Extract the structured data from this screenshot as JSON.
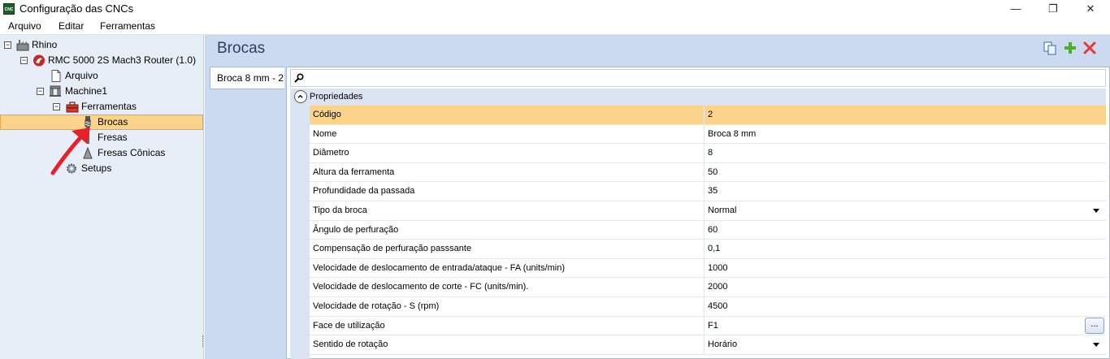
{
  "window": {
    "icon_text": "CNC",
    "title": "Configuração das CNCs",
    "minimize": "—",
    "maximize": "❐",
    "close": "✕"
  },
  "menu": [
    "Arquivo",
    "Editar",
    "Ferramentas"
  ],
  "tree": {
    "root": "Rhino",
    "machine_config": "RMC 5000 2S Mach3 Router (1.0)",
    "arquivo": "Arquivo",
    "machine": "Machine1",
    "ferramentas": "Ferramentas",
    "brocas": "Brocas",
    "fresas": "Fresas",
    "fresas_conicas": "Fresas Cônicas",
    "setups": "Setups",
    "collapse_glyph": "−"
  },
  "panel": {
    "title": "Brocas",
    "tab_label": "Broca 8 mm - 2",
    "category": "Propriedades",
    "ellipsis": "..."
  },
  "properties": [
    {
      "name": "Código",
      "value": "2"
    },
    {
      "name": "Nome",
      "value": "Broca 8 mm"
    },
    {
      "name": "Diâmetro",
      "value": "8"
    },
    {
      "name": "Altura da ferramenta",
      "value": "50"
    },
    {
      "name": "Profundidade da passada",
      "value": "35"
    },
    {
      "name": "Tipo da broca",
      "value": "Normal"
    },
    {
      "name": "Ângulo de perfuração",
      "value": "60"
    },
    {
      "name": "Compensação de perfuração passsante",
      "value": "0,1"
    },
    {
      "name": "Velocidade de deslocamento de entrada/ataque - FA (units/min)",
      "value": "1000"
    },
    {
      "name": "Velocidade de deslocamento de corte - FC (units/min).",
      "value": "2000"
    },
    {
      "name": "Velocidade de rotação - S (rpm)",
      "value": "4500"
    },
    {
      "name": "Face de utilização",
      "value": "F1"
    },
    {
      "name": "Sentido de rotação",
      "value": "Horário"
    }
  ],
  "colors": {
    "selection": "#fbd38a",
    "panel_bg": "#ccdaf0",
    "tree_bg": "#e8eef8",
    "annotation_arrow": "#e8202a"
  }
}
